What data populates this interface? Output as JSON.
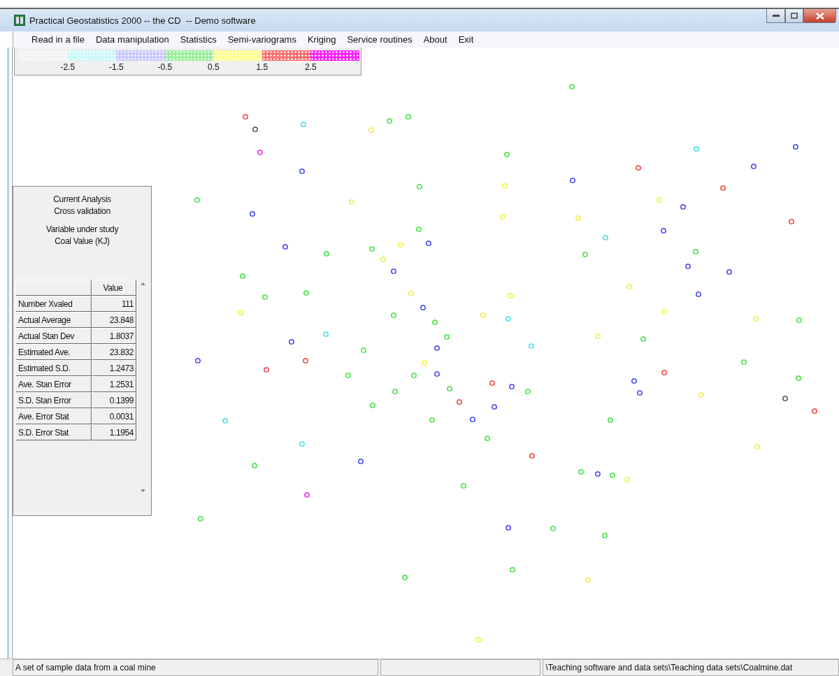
{
  "window": {
    "title": "Practical Geostatistics 2000 -- the CD  -- Demo software"
  },
  "menu": [
    "Read in a file",
    "Data manipulation",
    "Statistics",
    "Semi-variograms",
    "Kriging",
    "Service routines",
    "About",
    "Exit"
  ],
  "legend": {
    "swatches": [
      {
        "color": "#f2f2f2"
      },
      {
        "color": "#c8f8f8"
      },
      {
        "color": "#c8c8ff"
      },
      {
        "color": "#99ee99"
      },
      {
        "color": "#ffff88"
      },
      {
        "color": "#ff7070"
      },
      {
        "color": "#ff22ff"
      }
    ],
    "labels": [
      "-2.5",
      "-1.5",
      "-0.5",
      "0.5",
      "1.5",
      "2.5"
    ]
  },
  "panel": {
    "lines": [
      "Current Analysis",
      "Cross validation",
      "Variable under study",
      "Coal Value (KJ)"
    ],
    "table": {
      "header": "Value",
      "rows": [
        {
          "label": "Number Xvaled",
          "value": "111"
        },
        {
          "label": "Actual Average",
          "value": "23.848"
        },
        {
          "label": "Actual Stan Dev",
          "value": "1.8037"
        },
        {
          "label": "Estimated Ave.",
          "value": "23.832"
        },
        {
          "label": "Estimated S.D.",
          "value": "1.2473"
        },
        {
          "label": "Ave. Stan Error",
          "value": "1.2531"
        },
        {
          "label": "S.D. Stan Error",
          "value": "0.1399"
        },
        {
          "label": "Ave. Error Stat",
          "value": "0.0031"
        },
        {
          "label": "S.D. Error Stat",
          "value": "1.1954"
        }
      ]
    }
  },
  "status_bar": [
    "A set of sample data from a coal mine",
    "\\Teaching software and data sets\\Teaching data sets\\Coalmine.dat"
  ]
}
